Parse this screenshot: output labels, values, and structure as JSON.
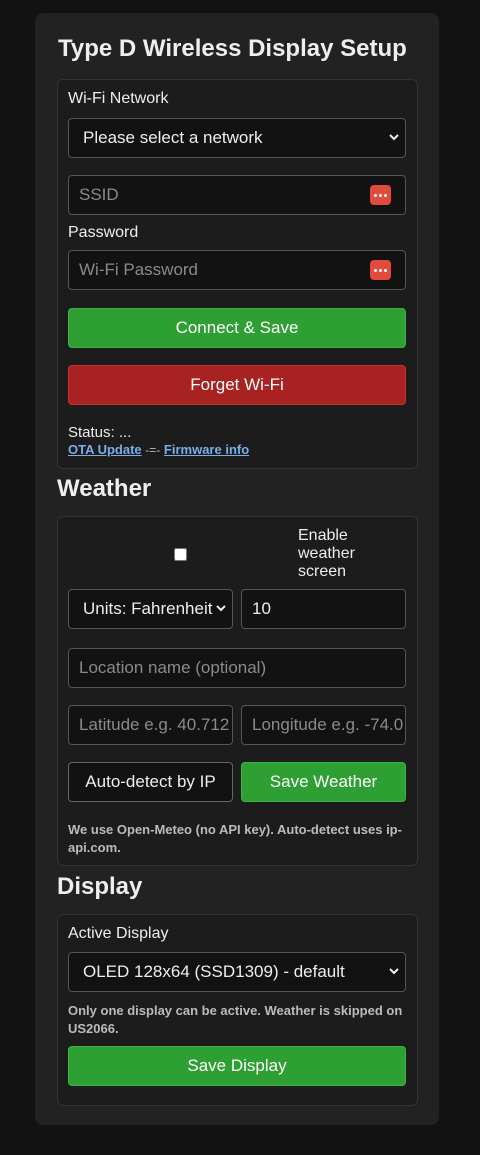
{
  "page": {
    "title": "Type D Wireless Display Setup"
  },
  "wifi": {
    "network_label": "Wi-Fi Network",
    "network_select": "Please select a network",
    "ssid_placeholder": "SSID",
    "password_label": "Password",
    "password_placeholder": "Wi-Fi Password",
    "connect_button": "Connect & Save",
    "forget_button": "Forget Wi-Fi",
    "status_text": "Status: ...",
    "ota_link": "OTA Update",
    "separator": "-=-",
    "firmware_link": "Firmware info",
    "password_manager_icon": "password-manager-icon"
  },
  "weather": {
    "heading": "Weather",
    "enable_label": "Enable weather screen",
    "units_select": "Units: Fahrenheit",
    "refresh_value": "10",
    "location_placeholder": "Location name (optional)",
    "latitude_placeholder": "Latitude e.g. 40.712",
    "longitude_placeholder": "Longitude e.g. -74.0",
    "autodetect_button": "Auto-detect by IP",
    "save_button": "Save Weather",
    "note": "We use Open-Meteo (no API key). Auto-detect uses ip-api.com."
  },
  "display": {
    "heading": "Display",
    "active_label": "Active Display",
    "active_select": "OLED 128x64 (SSD1309) - default",
    "note": "Only one display can be active. Weather is skipped on US2066.",
    "save_button": "Save Display"
  },
  "colors": {
    "accent_green": "#2e9f33",
    "danger_red": "#a82222",
    "link_blue": "#79aee8",
    "password_icon_red": "#e04b3c"
  }
}
